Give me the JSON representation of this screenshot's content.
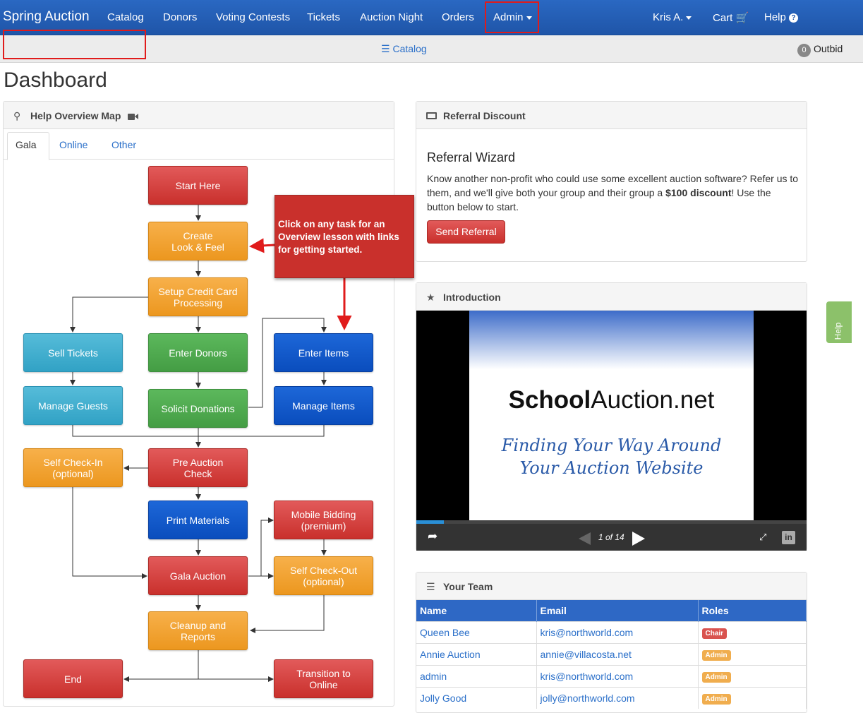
{
  "nav": {
    "brand": "Spring Auction",
    "items": [
      "Catalog",
      "Donors",
      "Voting Contests",
      "Tickets",
      "Auction Night",
      "Orders"
    ],
    "admin": "Admin",
    "user": "Kris A.",
    "cart": "Cart",
    "help": "Help"
  },
  "subbar": {
    "catalog": "Catalog",
    "outbid_count": "0",
    "outbid_label": "Outbid"
  },
  "page": {
    "title": "Dashboard"
  },
  "help_map": {
    "title": "Help Overview Map",
    "tabs": [
      "Gala",
      "Online",
      "Other"
    ],
    "callout": "Click on any task for an Overview lesson with links for getting started.",
    "boxes": {
      "start": "Start Here",
      "create": "Create\nLook & Feel",
      "credit": "Setup Credit Card\nProcessing",
      "sell": "Sell Tickets",
      "donors": "Enter Donors",
      "items": "Enter Items",
      "guests": "Manage Guests",
      "solicit": "Solicit Donations",
      "manage_items": "Manage Items",
      "checkin": "Self Check-In\n(optional)",
      "pre": "Pre Auction\nCheck",
      "print": "Print Materials",
      "mobile": "Mobile Bidding\n(premium)",
      "gala": "Gala Auction",
      "checkout": "Self Check-Out\n(optional)",
      "cleanup": "Cleanup and\nReports",
      "end": "End",
      "transition": "Transition to\nOnline"
    }
  },
  "referral": {
    "title": "Referral Discount",
    "heading": "Referral Wizard",
    "text_before": "Know another non-profit who could use some excellent auction software? Refer us to them, and we'll give both your group and their group a ",
    "text_bold": "$100 discount",
    "text_after": "! Use the button below to start.",
    "button": "Send Referral"
  },
  "intro": {
    "title": "Introduction",
    "slide_logo_bold": "School",
    "slide_logo_rest": "Auction.net",
    "slide_line1": "Finding Your Way Around",
    "slide_line2": "Your Auction Website",
    "counter": "1 of 14",
    "progress": 0.07
  },
  "team": {
    "title": "Your Team",
    "columns": [
      "Name",
      "Email",
      "Roles"
    ],
    "rows": [
      {
        "name": "Queen Bee",
        "email": "kris@northworld.com",
        "role": "Chair",
        "role_color": "#d9534f"
      },
      {
        "name": "Annie Auction",
        "email": "annie@villacosta.net",
        "role": "Admin",
        "role_color": "#f0ad4e"
      },
      {
        "name": "admin",
        "email": "kris@northworld.com",
        "role": "Admin",
        "role_color": "#f0ad4e"
      },
      {
        "name": "Jolly Good",
        "email": "jolly@northworld.com",
        "role": "Admin",
        "role_color": "#f0ad4e"
      }
    ]
  },
  "help_tab": "Help"
}
